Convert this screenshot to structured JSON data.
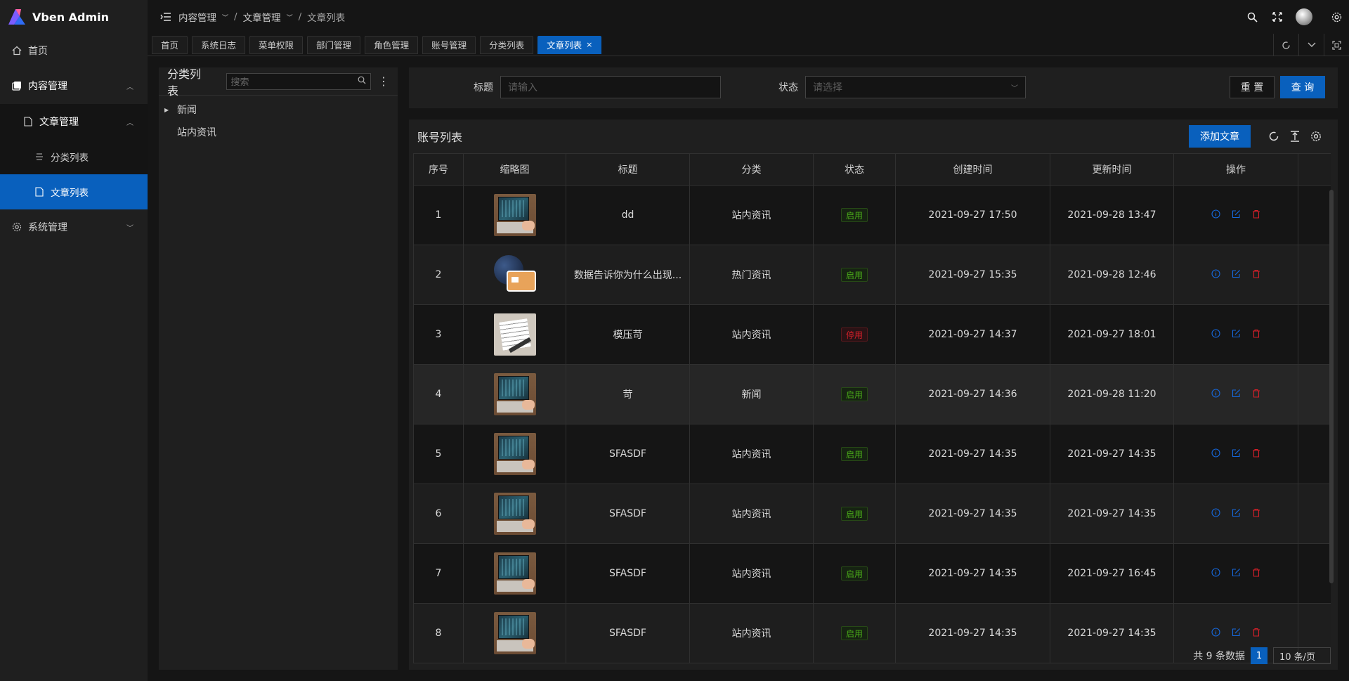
{
  "app": {
    "name": "Vben Admin"
  },
  "sidebar": {
    "items": [
      {
        "label": "首页",
        "icon": "home-icon"
      },
      {
        "label": "内容管理",
        "icon": "content-icon"
      },
      {
        "label": "文章管理",
        "icon": "file-icon"
      },
      {
        "label": "分类列表",
        "icon": "list-icon"
      },
      {
        "label": "文章列表",
        "icon": "file-icon"
      },
      {
        "label": "系统管理",
        "icon": "gear-icon"
      }
    ]
  },
  "header": {
    "breadcrumb": [
      "内容管理",
      "文章管理",
      "文章列表"
    ]
  },
  "tabs": [
    {
      "label": "首页"
    },
    {
      "label": "系统日志"
    },
    {
      "label": "菜单权限"
    },
    {
      "label": "部门管理"
    },
    {
      "label": "角色管理"
    },
    {
      "label": "账号管理"
    },
    {
      "label": "分类列表"
    },
    {
      "label": "文章列表",
      "close": "×"
    }
  ],
  "tree": {
    "title": "分类列表",
    "search_placeholder": "搜索",
    "nodes": [
      "新闻",
      "站内资讯"
    ]
  },
  "search_form": {
    "title_label": "标题",
    "title_placeholder": "请输入",
    "status_label": "状态",
    "status_placeholder": "请选择",
    "reset_label": "重 置",
    "query_label": "查 询"
  },
  "table": {
    "title": "账号列表",
    "add_label": "添加文章",
    "columns": [
      "序号",
      "缩略图",
      "标题",
      "分类",
      "状态",
      "创建时间",
      "更新时间",
      "操作"
    ],
    "rows": [
      {
        "idx": "1",
        "title": "dd",
        "category": "站内资讯",
        "status": "启用",
        "created": "2021-09-27 17:50",
        "updated": "2021-09-28 13:47"
      },
      {
        "idx": "2",
        "title": "数据告诉你为什么出现...",
        "category": "热门资讯",
        "status": "启用",
        "created": "2021-09-27 15:35",
        "updated": "2021-09-28 12:46"
      },
      {
        "idx": "3",
        "title": "模压苛",
        "category": "站内资讯",
        "status": "停用",
        "created": "2021-09-27 14:37",
        "updated": "2021-09-27 18:01"
      },
      {
        "idx": "4",
        "title": "苛",
        "category": "新闻",
        "status": "启用",
        "created": "2021-09-27 14:36",
        "updated": "2021-09-28 11:20"
      },
      {
        "idx": "5",
        "title": "SFASDF",
        "category": "站内资讯",
        "status": "启用",
        "created": "2021-09-27 14:35",
        "updated": "2021-09-27 14:35"
      },
      {
        "idx": "6",
        "title": "SFASDF",
        "category": "站内资讯",
        "status": "启用",
        "created": "2021-09-27 14:35",
        "updated": "2021-09-27 14:35"
      },
      {
        "idx": "7",
        "title": "SFASDF",
        "category": "站内资讯",
        "status": "启用",
        "created": "2021-09-27 14:35",
        "updated": "2021-09-27 16:45"
      },
      {
        "idx": "8",
        "title": "SFASDF",
        "category": "站内资讯",
        "status": "启用",
        "created": "2021-09-27 14:35",
        "updated": "2021-09-27 14:35"
      }
    ]
  },
  "pagination": {
    "total_text": "共 9 条数据",
    "current": "1",
    "page_size": "10 条/页"
  },
  "colors": {
    "primary": "#0960bd",
    "success": "#49aa19",
    "danger": "#d32029"
  }
}
